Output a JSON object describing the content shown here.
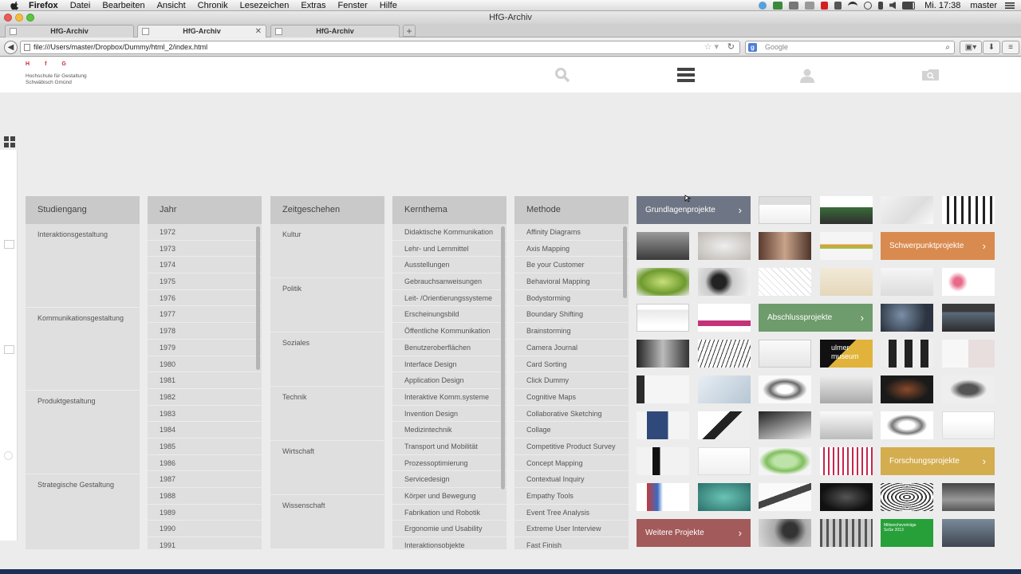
{
  "menubar": {
    "app": "Firefox",
    "items": [
      "Datei",
      "Bearbeiten",
      "Ansicht",
      "Chronik",
      "Lesezeichen",
      "Extras",
      "Fenster",
      "Hilfe"
    ],
    "clock": "Mi. 17:38",
    "user": "master"
  },
  "window": {
    "title": "HfG-Archiv"
  },
  "tabs": [
    {
      "label": "HfG-Archiv",
      "active": false
    },
    {
      "label": "HfG-Archiv",
      "active": true
    },
    {
      "label": "HfG-Archiv",
      "active": false
    }
  ],
  "newtab": "+",
  "address": {
    "url": "file:///Users/master/Dropbox/Dummy/html_2/index.html"
  },
  "search": {
    "engine": "g",
    "placeholder": "Google"
  },
  "site": {
    "logo_top": [
      "H",
      "f",
      "G"
    ],
    "logo_line1": "Hochschule für Gestaltung",
    "logo_line2": "Schwäbisch Gmünd",
    "header_icons": [
      "search-icon",
      "menu-icon",
      "user-icon",
      "folder-icon"
    ]
  },
  "columns": {
    "studiengang": {
      "title": "Studiengang",
      "items": [
        "Interaktionsgestaltung",
        "Kommunikationsgestaltung",
        "Produktgestaltung",
        "Strategische Gestaltung"
      ]
    },
    "jahr": {
      "title": "Jahr",
      "items": [
        "1972",
        "1973",
        "1974",
        "1975",
        "1976",
        "1977",
        "1978",
        "1979",
        "1980",
        "1981",
        "1982",
        "1983",
        "1984",
        "1985",
        "1986",
        "1987",
        "1988",
        "1989",
        "1990",
        "1991"
      ]
    },
    "zeitgeschehen": {
      "title": "Zeitgeschehen",
      "items": [
        "Kultur",
        "Politik",
        "Soziales",
        "Technik",
        "Wirtschaft",
        "Wissenschaft"
      ]
    },
    "kernthema": {
      "title": "Kernthema",
      "items": [
        "Didaktische Kommunikation",
        "Lehr- und Lernmittel",
        "Ausstellungen",
        "Gebrauchsanweisungen",
        "Leit- /Orientierungssysteme",
        "Erscheinungsbild",
        "Öffentliche Kommunikation",
        "Benutzeroberflächen",
        "Interface Design",
        "Application Design",
        "Interaktive Komm.systeme",
        "Invention Design",
        "Medizintechnik",
        "Transport und Mobilität",
        "Prozessoptimierung",
        "Servicedesign",
        "Körper und Bewegung",
        "Fabrikation und Robotik",
        "Ergonomie und Usability",
        "Interaktionsobjekte"
      ]
    },
    "methode": {
      "title": "Methode",
      "items": [
        "Affinity Diagrams",
        "Axis Mapping",
        "Be your Customer",
        "Behavioral Mapping",
        "Bodystorming",
        "Boundary Shifting",
        "Brainstorming",
        "Camera Journal",
        "Card Sorting",
        "Click Dummy",
        "Cognitive Maps",
        "Collaborative Sketching",
        "Collage",
        "Competitive Product Survey",
        "Concept Mapping",
        "Contextual Inquiry",
        "Empathy Tools",
        "Event Tree Analysis",
        "Extreme User Interview",
        "Fast Finish"
      ]
    }
  },
  "categories": {
    "grundlagen": {
      "label": "Grundlagenprojekte",
      "color": "#6e7585"
    },
    "schwerpunkt": {
      "label": "Schwerpunktprojekte",
      "color": "#d98a4e"
    },
    "abschluss": {
      "label": "Abschlussprojekte",
      "color": "#6e9c6c"
    },
    "forschung": {
      "label": "Forschungsprojekte",
      "color": "#d4ad4f"
    },
    "weitere": {
      "label": "Weitere Projekte",
      "color": "#a35a5a"
    }
  },
  "thumb_captions": {
    "ulmer": "ulmer museum",
    "mittwoch_line1": "Mittwochsvorträge",
    "mittwoch_line2": "SoSe 2013"
  }
}
